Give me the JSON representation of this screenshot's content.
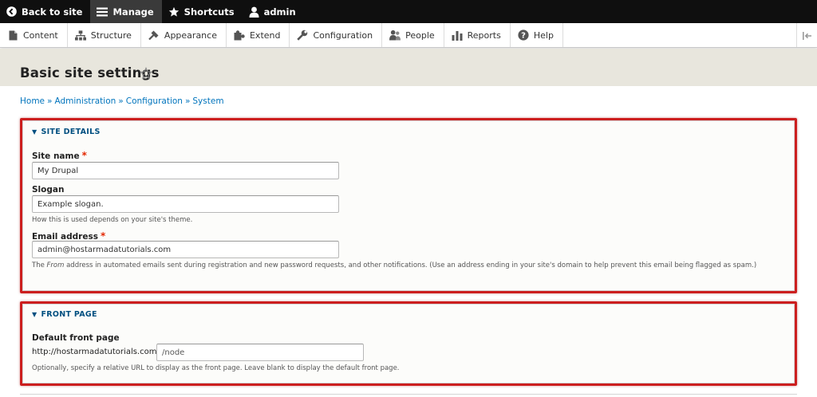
{
  "toolbar": {
    "back_label": "Back to site",
    "manage_label": "Manage",
    "shortcuts_label": "Shortcuts",
    "user_label": "admin"
  },
  "tray": {
    "items": [
      {
        "label": "Content",
        "icon": "content-icon"
      },
      {
        "label": "Structure",
        "icon": "structure-icon"
      },
      {
        "label": "Appearance",
        "icon": "appearance-icon"
      },
      {
        "label": "Extend",
        "icon": "extend-icon"
      },
      {
        "label": "Configuration",
        "icon": "configuration-icon"
      },
      {
        "label": "People",
        "icon": "people-icon"
      },
      {
        "label": "Reports",
        "icon": "reports-icon"
      },
      {
        "label": "Help",
        "icon": "help-icon"
      }
    ]
  },
  "page": {
    "title": "Basic site settings"
  },
  "breadcrumb": {
    "items": [
      "Home",
      "Administration",
      "Configuration",
      "System"
    ],
    "separator": "»"
  },
  "site_details": {
    "legend": "SITE DETAILS",
    "site_name": {
      "label": "Site name",
      "value": "My Drupal",
      "required": true
    },
    "slogan": {
      "label": "Slogan",
      "value": "Example slogan.",
      "description": "How this is used depends on your site's theme."
    },
    "email": {
      "label": "Email address",
      "value": "admin@hostarmadatutorials.com",
      "required": true,
      "description_prefix": "The ",
      "description_em": "From",
      "description_suffix": " address in automated emails sent during registration and new password requests, and other notifications. (Use an address ending in your site's domain to help prevent this email being flagged as spam.)"
    }
  },
  "front_page": {
    "legend": "FRONT PAGE",
    "default_label": "Default front page",
    "url_prefix": "http://hostarmadatutorials.com",
    "placeholder": "/node",
    "description": "Optionally, specify a relative URL to display as the front page. Leave blank to display the default front page."
  },
  "colors": {
    "toolbar_bg": "#0f0f0f",
    "link": "#0074bd",
    "legend": "#004f80",
    "required": "#e32700",
    "highlight_border": "#cc1e1e",
    "header_band": "#e8e6dd"
  }
}
